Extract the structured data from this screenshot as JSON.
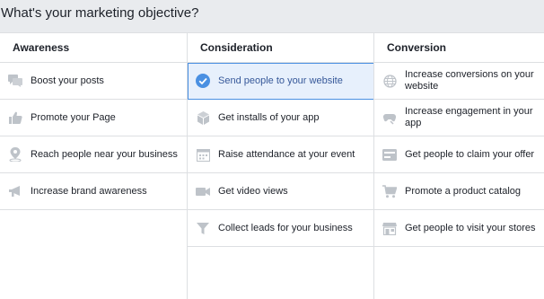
{
  "header": {
    "title": "What's your marketing objective?"
  },
  "columns": [
    {
      "heading": "Awareness",
      "items": [
        {
          "label": "Boost your posts",
          "icon": "chat-bubbles-icon"
        },
        {
          "label": "Promote your Page",
          "icon": "thumbs-up-icon"
        },
        {
          "label": "Reach people near your business",
          "icon": "map-pin-icon"
        },
        {
          "label": "Increase brand awareness",
          "icon": "megaphone-icon"
        }
      ]
    },
    {
      "heading": "Consideration",
      "items": [
        {
          "label": "Send people to your website",
          "icon": "check-circle-icon",
          "selected": true
        },
        {
          "label": "Get installs of your app",
          "icon": "cube-icon"
        },
        {
          "label": "Raise attendance at your event",
          "icon": "calendar-icon"
        },
        {
          "label": "Get video views",
          "icon": "video-camera-icon"
        },
        {
          "label": "Collect leads for your business",
          "icon": "funnel-icon"
        }
      ]
    },
    {
      "heading": "Conversion",
      "items": [
        {
          "label": "Increase conversions on your website",
          "icon": "globe-icon"
        },
        {
          "label": "Increase engagement in your app",
          "icon": "engagement-icon"
        },
        {
          "label": "Get people to claim your offer",
          "icon": "offer-icon"
        },
        {
          "label": "Promote a product catalog",
          "icon": "shopping-cart-icon"
        },
        {
          "label": "Get people to visit your stores",
          "icon": "store-icon"
        }
      ]
    }
  ],
  "colors": {
    "icon": "#bec3c9",
    "accent": "#4a90e2",
    "selectedBg": "#e7f0fc"
  }
}
